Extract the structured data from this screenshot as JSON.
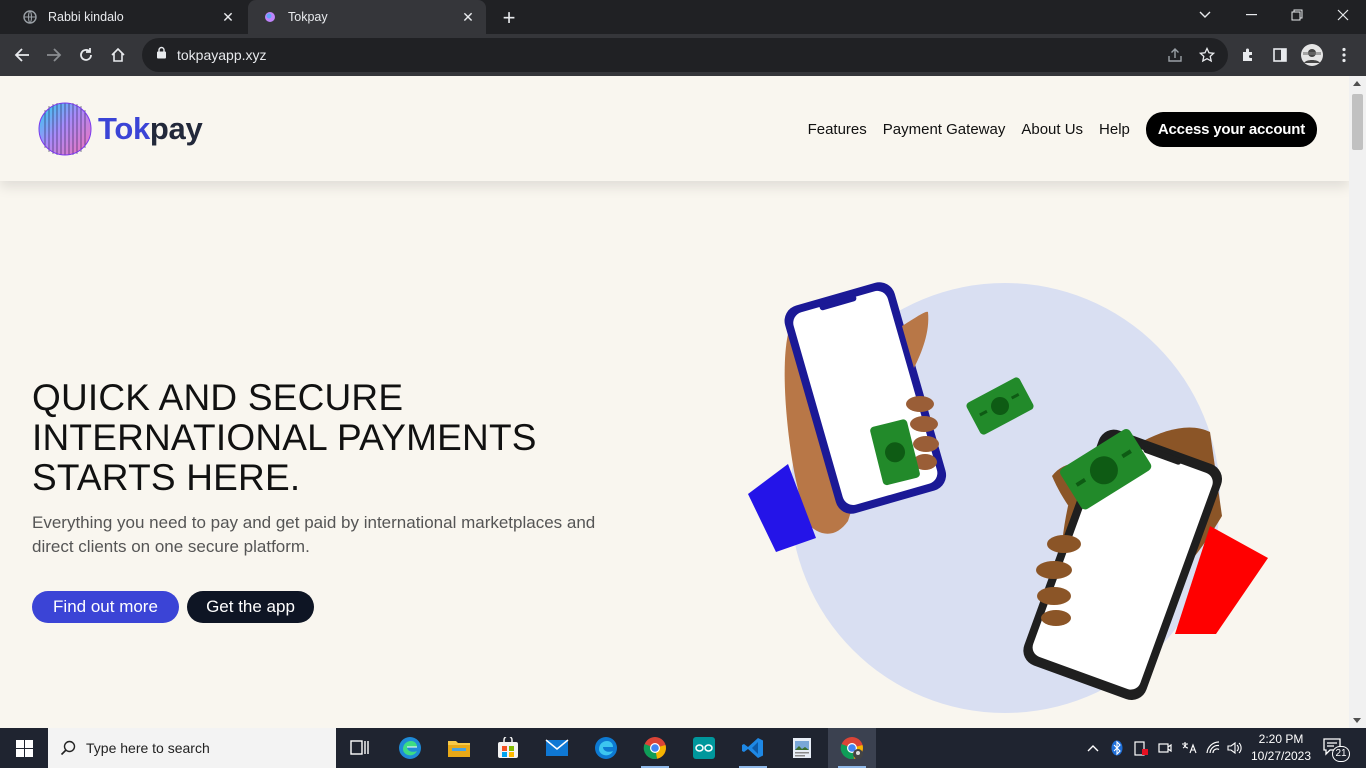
{
  "browser": {
    "tabs": [
      {
        "title": "Rabbi kindalo",
        "active": false
      },
      {
        "title": "Tokpay",
        "active": true
      }
    ],
    "url": "tokpayapp.xyz"
  },
  "site": {
    "brand_first": "Tok",
    "brand_second": "pay",
    "nav": [
      "Features",
      "Payment Gateway",
      "About Us",
      "Help"
    ],
    "cta": "Access your account",
    "hero": {
      "title_lines": [
        "QUICK AND SECURE",
        "INTERNATIONAL PAYMENTS",
        "STARTS HERE."
      ],
      "subtitle_lines": [
        "Everything you need to pay and get paid by international marketplaces and",
        "direct clients on one secure platform."
      ],
      "primary_button": "Find out more",
      "secondary_button": "Get the app"
    },
    "colors": {
      "brand": "#3b44d6",
      "dark": "#0e1524",
      "background": "#f9f6ef"
    }
  },
  "taskbar": {
    "search_placeholder": "Type here to search",
    "time": "2:20 PM",
    "date": "10/27/2023",
    "notification_count": "21",
    "apps": [
      "task-view-icon",
      "edge-icon",
      "file-explorer-icon",
      "store-icon",
      "mail-icon",
      "edge-icon",
      "chrome-icon",
      "arduino-icon",
      "vscode-icon",
      "image-viewer-icon",
      "chrome-icon"
    ]
  }
}
